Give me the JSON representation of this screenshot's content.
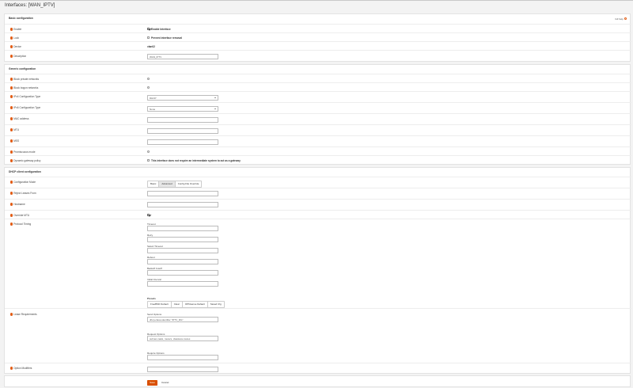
{
  "page": {
    "title": "Interfaces: [WAN_IPTV]"
  },
  "basic": {
    "heading": "Basic configuration",
    "full_help": "full help",
    "enable": {
      "label": "Enable",
      "checked": true,
      "text": "Enable Interface"
    },
    "lock": {
      "label": "Lock",
      "checked": false,
      "text": "Prevent interface removal"
    },
    "device": {
      "label": "Device",
      "value": "vlan02"
    },
    "description": {
      "label": "Description",
      "value": "WAN_IPTV"
    }
  },
  "generic": {
    "heading": "Generic configuration",
    "block_private": {
      "label": "Block private networks"
    },
    "block_bogon": {
      "label": "Block bogon networks"
    },
    "ipv4_type": {
      "label": "IPv4 Configuration Type",
      "value": "DHCP"
    },
    "ipv6_type": {
      "label": "IPv6 Configuration Type",
      "value": "None"
    },
    "mac": {
      "label": "MAC address",
      "value": ""
    },
    "mtu": {
      "label": "MTU",
      "value": ""
    },
    "mss": {
      "label": "MSS",
      "value": ""
    },
    "promiscuous": {
      "label": "Promiscuous mode"
    },
    "dyn_gateway": {
      "label": "Dynamic gateway policy",
      "text": "This interface does not require an intermediate system to act as a gateway"
    }
  },
  "dhcp": {
    "heading": "DHCP client configuration",
    "config_mode": {
      "label": "Configuration Mode",
      "options": [
        "Basic",
        "Advanced",
        "Config File Override"
      ],
      "selected": "Advanced"
    },
    "reject_leases": {
      "label": "Reject Leases From",
      "value": ""
    },
    "hostname": {
      "label": "Hostname",
      "value": ""
    },
    "override_mtu": {
      "label": "Override MTU",
      "checked": true
    },
    "protocol_timing": {
      "label": "Protocol Timing",
      "fields": [
        "Timeout",
        "Retry",
        "Select Timeout",
        "Reboot",
        "Backoff Cutoff",
        "Initial Interval"
      ],
      "presets_label": "Presets",
      "presets": [
        "FreeBSD Default",
        "Clear",
        "OPNsense Default",
        "Saved Cfg"
      ]
    },
    "lease_req": {
      "label": "Lease Requirements",
      "send_label": "Send Options",
      "send_value": "dhcp-class-identifier \"IPTV_RG\"",
      "request_label": "Request Options",
      "request_value": "subnet-mask, routers, classless-routes",
      "require_label": "Require Options",
      "require_value": ""
    },
    "option_modifiers": {
      "label": "Option Modifiers",
      "value": ""
    }
  },
  "actions": {
    "save": "Save",
    "cancel": "Cancel"
  },
  "colors": {
    "accent": "#d94f00",
    "info": "#e25d16"
  }
}
